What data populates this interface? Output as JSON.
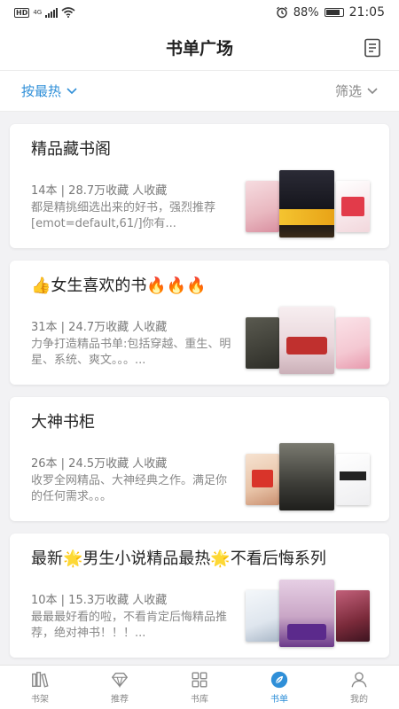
{
  "status": {
    "hd": "HD",
    "net": "4G",
    "battery": "88%",
    "time": "21:05"
  },
  "header": {
    "title": "书单广场"
  },
  "filters": {
    "sort_label": "按最热",
    "filter_label": "筛选",
    "accent": "#2f8fd8"
  },
  "booklists": [
    {
      "title": "精品藏书阁",
      "stats": "14本 | 28.7万收藏 人收藏",
      "desc": "都是精挑细选出来的好书，强烈推荐[emot=default,61/]你有...",
      "covers": [
        "#e9b8c0",
        "#1c1c24",
        "#f2d7dc"
      ]
    },
    {
      "title": "👍女生喜欢的书🔥🔥🔥",
      "stats": "31本 | 24.7万收藏 人收藏",
      "desc": "力争打造精品书单:包括穿越、重生、明星、系统、爽文。。。...",
      "covers": [
        "#3a3a34",
        "#efe3e6",
        "#f4c8d2"
      ]
    },
    {
      "title": "大神书柜",
      "stats": "26本 | 24.5万收藏 人收藏",
      "desc": "收罗全网精品、大神经典之作。满足你的任何需求。。。",
      "covers": [
        "#e8c4a8",
        "#4a4a44",
        "#f0f0f2"
      ]
    },
    {
      "title": "最新🌟男生小说精品最热🌟不看后悔系列",
      "stats": "10本 | 15.3万收藏 人收藏",
      "desc": "最最最好看的啦，不看肯定后悔精品推荐，绝对神书！！！...",
      "covers": [
        "#dfe6ee",
        "#c9a6c6",
        "#7a2a3a"
      ]
    }
  ],
  "tabs": [
    {
      "label": "书架",
      "icon": "bookshelf-icon"
    },
    {
      "label": "推荐",
      "icon": "diamond-icon"
    },
    {
      "label": "书库",
      "icon": "grid-icon"
    },
    {
      "label": "书单",
      "icon": "leaf-icon",
      "active": true
    },
    {
      "label": "我的",
      "icon": "user-icon"
    }
  ]
}
